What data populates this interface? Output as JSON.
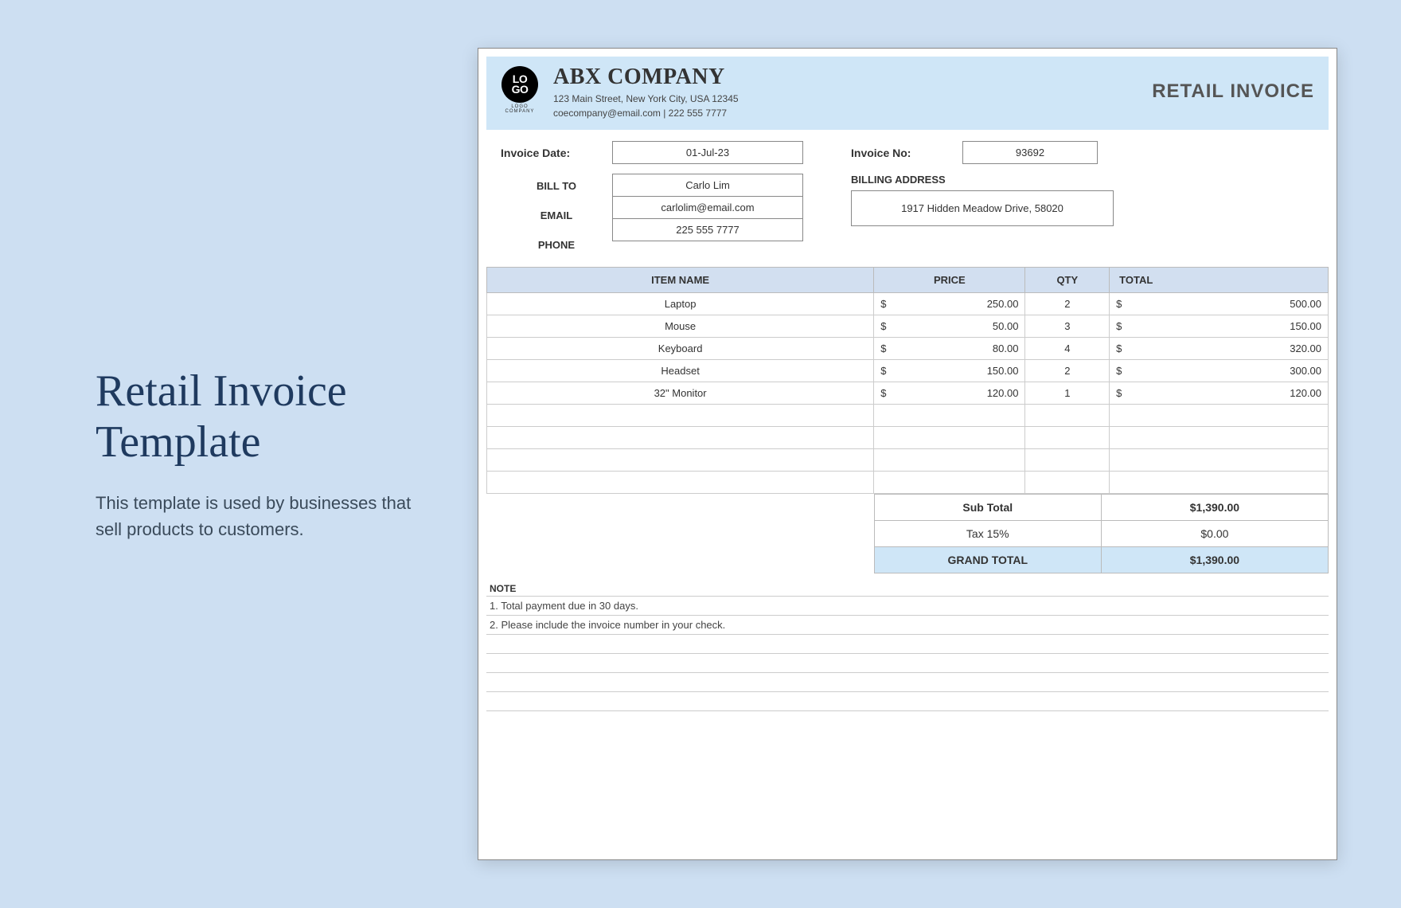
{
  "left": {
    "title": "Retail Invoice Template",
    "desc": "This template is used by businesses that sell products to customers."
  },
  "logo": {
    "text": "LO\nGO",
    "sub": "LOGO COMPANY"
  },
  "company": {
    "name": "ABX COMPANY",
    "address": "123 Main Street, New York City, USA 12345",
    "contact": "coecompany@email.com | 222 555 7777"
  },
  "invoiceTitle": "RETAIL INVOICE",
  "labels": {
    "invoiceDate": "Invoice Date:",
    "invoiceNo": "Invoice No:",
    "billTo": "BILL TO",
    "email": "EMAIL",
    "phone": "PHONE",
    "billingAddress": "BILLING ADDRESS",
    "itemName": "ITEM NAME",
    "price": "PRICE",
    "qty": "QTY",
    "total": "TOTAL",
    "subTotal": "Sub Total",
    "tax": "Tax 15%",
    "grandTotal": "GRAND TOTAL",
    "note": "NOTE"
  },
  "invoice": {
    "date": "01-Jul-23",
    "number": "93692",
    "billTo": "Carlo Lim",
    "email": "carlolim@email.com",
    "phone": "225 555 7777",
    "billingAddress": "1917 Hidden Meadow Drive, 58020"
  },
  "items": [
    {
      "name": "Laptop",
      "price": "250.00",
      "qty": "2",
      "total": "500.00"
    },
    {
      "name": "Mouse",
      "price": "50.00",
      "qty": "3",
      "total": "150.00"
    },
    {
      "name": "Keyboard",
      "price": "80.00",
      "qty": "4",
      "total": "320.00"
    },
    {
      "name": "Headset",
      "price": "150.00",
      "qty": "2",
      "total": "300.00"
    },
    {
      "name": "32\" Monitor",
      "price": "120.00",
      "qty": "1",
      "total": "120.00"
    }
  ],
  "blankRows": 4,
  "totals": {
    "subTotal": "$1,390.00",
    "tax": "$0.00",
    "grandTotal": "$1,390.00"
  },
  "notes": [
    "1. Total payment due in 30 days.",
    "2. Please include the invoice number in your check."
  ],
  "blankNotes": 4,
  "currency": "$"
}
